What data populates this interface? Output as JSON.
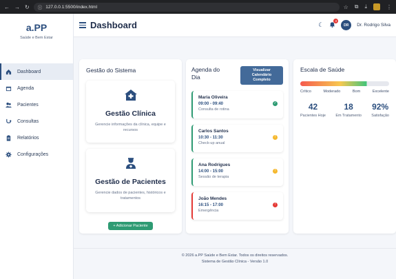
{
  "browser": {
    "url": "127.0.0.1:5500/index.html"
  },
  "brand": {
    "logo": "a.PP",
    "subtitle": "Saúde e Bem Estar"
  },
  "sidebar": {
    "items": [
      {
        "label": "Dashboard",
        "icon": "home-icon"
      },
      {
        "label": "Agenda",
        "icon": "calendar-icon"
      },
      {
        "label": "Pacientes",
        "icon": "users-icon"
      },
      {
        "label": "Consultas",
        "icon": "stethoscope-icon"
      },
      {
        "label": "Relatórios",
        "icon": "clipboard-icon"
      },
      {
        "label": "Configurações",
        "icon": "gear-icon"
      }
    ]
  },
  "header": {
    "title": "Dashboard",
    "notifications": "3",
    "avatar": "DR",
    "user": "Dr. Rodrigo Silva"
  },
  "gestao": {
    "title": "Gestão do Sistema",
    "clinica_title": "Gestão Clínica",
    "clinica_desc": "Gerencie informações da clínica, equipe e recursos",
    "pacientes_title": "Gestão de Pacientes",
    "pacientes_desc": "Gerencie dados de pacientes, históricos e tratamentos",
    "add_button": "+ Adicionar Paciente"
  },
  "agenda": {
    "title": "Agenda do Dia",
    "button": "Visualizar Calendário Completo",
    "appointments": [
      {
        "name": "Maria Oliveira",
        "time": "09:00 - 09:40",
        "type": "Consulta de rotina",
        "color": "#2e9b73",
        "status": "#2e9b73",
        "glyph": "✓"
      },
      {
        "name": "Carlos Santos",
        "time": "10:30 - 11:30",
        "type": "Check-up anual",
        "color": "#2e9b73",
        "status": "#f5b82e",
        "glyph": "!"
      },
      {
        "name": "Ana Rodrigues",
        "time": "14:00 - 15:00",
        "type": "Sessão de terapia",
        "color": "#2e9b73",
        "status": "#f5b82e",
        "glyph": "!"
      },
      {
        "name": "João Mendes",
        "time": "16:15 - 17:00",
        "type": "Emergência",
        "color": "#e53935",
        "status": "#e53935",
        "glyph": "!"
      }
    ]
  },
  "escala": {
    "title": "Escala de Saúde",
    "level": 0.75,
    "labels": [
      "Crítico",
      "Moderado",
      "Bom",
      "Excelente"
    ],
    "stats": [
      {
        "value": "42",
        "label": "Pacientes Hoje"
      },
      {
        "value": "18",
        "label": "Em Tratamento"
      },
      {
        "value": "92%",
        "label": "Satisfação"
      }
    ]
  },
  "footer": {
    "line1": "© 2026 a.PP Saúde e Bem Estar. Todos os direitos reservados.",
    "line2": "Sistema de Gestão Clínica - Versão 1.0"
  }
}
